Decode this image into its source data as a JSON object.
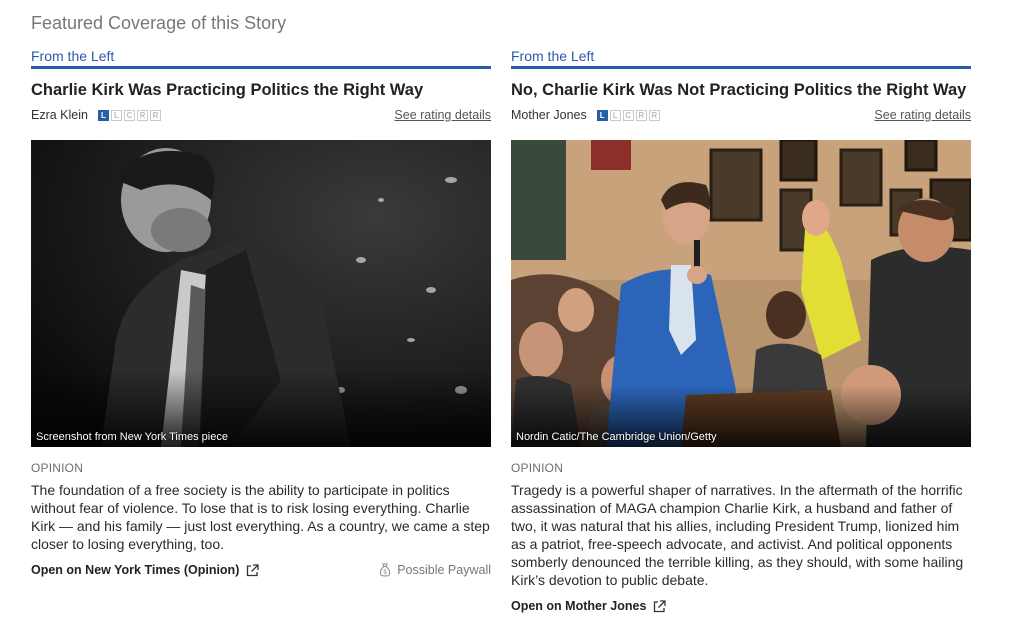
{
  "section": {
    "title": "Featured Coverage of this Story"
  },
  "rating_letters": [
    "L",
    "L",
    "C",
    "R",
    "R"
  ],
  "cards": [
    {
      "bias_label": "From the Left",
      "headline": "Charlie Kirk Was Practicing Politics the Right Way",
      "source": "Ezra Klein",
      "active_rating_index": 0,
      "see_rating": "See rating details",
      "image_caption": "Screenshot from New York Times piece",
      "tag": "OPINION",
      "summary": "The foundation of a free society is the ability to participate in politics without fear of violence. To lose that is to risk losing everything. Charlie Kirk — and his family — just lost everything. As a country, we came a step closer to losing everything, too.",
      "open_link": "Open on New York Times (Opinion)",
      "paywall": "Possible Paywall"
    },
    {
      "bias_label": "From the Left",
      "headline": "No, Charlie Kirk Was Not Practicing Politics the Right Way",
      "source": "Mother Jones",
      "active_rating_index": 0,
      "see_rating": "See rating details",
      "image_caption": "Nordin Catic/The Cambridge Union/Getty",
      "tag": "OPINION",
      "summary": "Tragedy is a powerful shaper of narratives. In the aftermath of the horrific assassination of MAGA champion Charlie Kirk, a husband and father of two, it was natural that his allies, including President Trump, lionized him as a patriot, free-speech advocate, and activist. And political opponents somberly denounced the terrible killing, as they should, with some hailing Kirk’s devotion to public debate.",
      "open_link": "Open on Mother Jones"
    }
  ]
}
